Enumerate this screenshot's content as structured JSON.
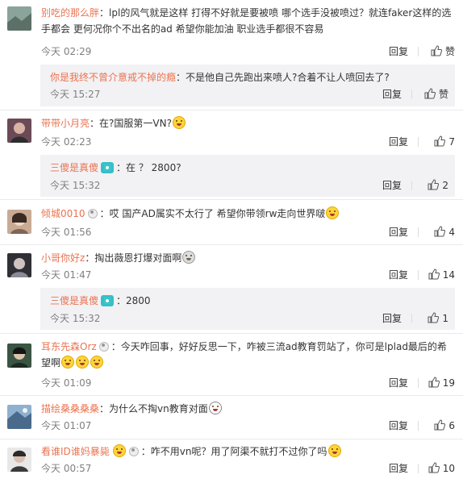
{
  "comments": [
    {
      "username": "别吃的那么胖",
      "text": "lpl的风气就是这样 打得不好就是要被喷 哪个选手没被喷过？就连faker这样的选手都会 更何况你个不出名的ad 希望你能加油 职业选手都很不容易",
      "time": "今天 02:29",
      "reply": "回复",
      "likes": "赞",
      "avatar_color": "#7a8b86"
    },
    {
      "username": "你是我终不曾介意戒不掉的瘾",
      "text": "不是他自己先跑出来喷人?合着不让人喷回去了?",
      "time": "今天 15:27",
      "reply": "回复",
      "likes": "赞"
    },
    {
      "username": "带带小月亮",
      "text": "在?国服第一VN?",
      "time": "今天 02:23",
      "reply": "回复",
      "likes": "7",
      "avatar_color": "#6a4a56"
    },
    {
      "username": "三傻是真傻",
      "text": "在 ？ 2800?",
      "time": "今天 15:32",
      "reply": "回复",
      "likes": "2"
    },
    {
      "username": "倾城0010",
      "text": "哎 国产AD属实不太行了 希望你带领rw走向世界啵",
      "time": "今天 01:56",
      "reply": "回复",
      "likes": "4",
      "avatar_color": "#b08a72"
    },
    {
      "username": "小哥你好z",
      "text": "掏出薇恩打爆对面啊",
      "time": "今天 01:47",
      "reply": "回复",
      "likes": "14",
      "avatar_color": "#3b3b42"
    },
    {
      "username": "三傻是真傻",
      "text": "2800",
      "time": "今天 15:32",
      "reply": "回复",
      "likes": "1"
    },
    {
      "username": "耳东先森Orz",
      "text": "今天咋回事，好好反思一下，咋被三流ad教育罚站了，你可是lplad最后的希望啊",
      "time": "今天 01:09",
      "reply": "回复",
      "likes": "19",
      "avatar_color": "#4d6b55"
    },
    {
      "username": "描绘桑桑桑桑",
      "text": "为什么不掏vn教育对面",
      "time": "今天 01:07",
      "reply": "回复",
      "likes": "6",
      "avatar_color": "#4a6a8c"
    },
    {
      "username": "看谁ID谁妈暴毙",
      "text": "咋不用vn呢？用了阿渠不就打不过你了吗",
      "time": "今天 00:57",
      "reply": "回复",
      "likes": "10",
      "avatar_color": "#5a5a5a"
    }
  ]
}
